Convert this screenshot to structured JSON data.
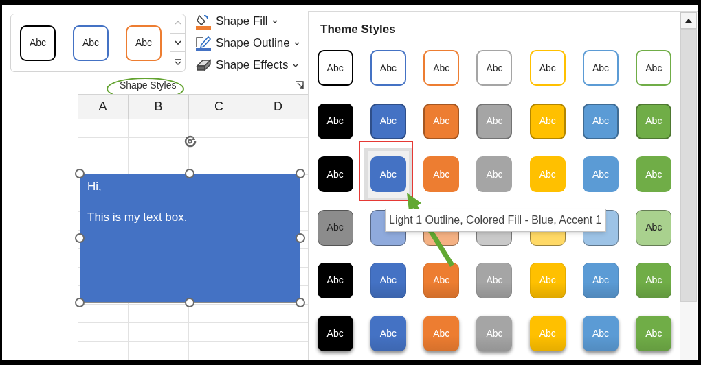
{
  "ribbon": {
    "gallery": {
      "styles": [
        {
          "label": "Abc",
          "color": "#000000"
        },
        {
          "label": "Abc",
          "color": "#4472c4"
        },
        {
          "label": "Abc",
          "color": "#ed7d31"
        }
      ],
      "scroll_buttons": [
        {
          "kind": "up",
          "disabled": true
        },
        {
          "kind": "down",
          "disabled": false
        },
        {
          "kind": "more",
          "disabled": false
        }
      ]
    },
    "commands": [
      {
        "kind": "fill",
        "label": "Shape Fill"
      },
      {
        "kind": "outline",
        "label": "Shape Outline"
      },
      {
        "kind": "effects",
        "label": "Shape Effects"
      }
    ],
    "group_label": "Shape Styles"
  },
  "sheet": {
    "columns": [
      "A",
      "B",
      "C",
      "D"
    ],
    "text_box": {
      "paragraphs": [
        "Hi,",
        "This is my text box."
      ]
    }
  },
  "panel": {
    "title": "Theme Styles",
    "rows": [
      {
        "kind": "outline",
        "tiles": [
          {
            "label": "Abc",
            "color": "#000000",
            "selected": false
          },
          {
            "label": "Abc",
            "color": "#4472c4",
            "selected": false
          },
          {
            "label": "Abc",
            "color": "#ed7d31",
            "selected": false
          },
          {
            "label": "Abc",
            "color": "#a5a5a5",
            "selected": false
          },
          {
            "label": "Abc",
            "color": "#ffc000",
            "selected": false
          },
          {
            "label": "Abc",
            "color": "#5b9bd5",
            "selected": false
          },
          {
            "label": "Abc",
            "color": "#70ad47",
            "selected": false
          }
        ]
      },
      {
        "kind": "solid",
        "tiles": [
          {
            "label": "Abc",
            "color": "#000000",
            "selected": false
          },
          {
            "label": "Abc",
            "color": "#4472c4",
            "selected": false
          },
          {
            "label": "Abc",
            "color": "#ed7d31",
            "selected": false
          },
          {
            "label": "Abc",
            "color": "#a5a5a5",
            "selected": false
          },
          {
            "label": "Abc",
            "color": "#ffc000",
            "selected": false
          },
          {
            "label": "Abc",
            "color": "#5b9bd5",
            "selected": false
          },
          {
            "label": "Abc",
            "color": "#70ad47",
            "selected": false
          }
        ]
      },
      {
        "kind": "flat",
        "tiles": [
          {
            "label": "Abc",
            "color": "#000000",
            "selected": false
          },
          {
            "label": "Abc",
            "color": "#4472c4",
            "selected": true
          },
          {
            "label": "Abc",
            "color": "#ed7d31",
            "selected": false
          },
          {
            "label": "Abc",
            "color": "#a5a5a5",
            "selected": false
          },
          {
            "label": "Abc",
            "color": "#ffc000",
            "selected": false
          },
          {
            "label": "Abc",
            "color": "#5b9bd5",
            "selected": false
          },
          {
            "label": "Abc",
            "color": "#70ad47",
            "selected": false
          }
        ]
      },
      {
        "kind": "light",
        "tiles": [
          {
            "label": "Abc",
            "color": "#8c8c8c",
            "selected": false
          },
          {
            "color": "#8faadc",
            "selected": false
          },
          {
            "color": "#f4b183",
            "selected": false
          },
          {
            "color": "#c9c9c9",
            "selected": false
          },
          {
            "color": "#ffd966",
            "selected": false
          },
          {
            "color": "#9dc3e6",
            "selected": false
          },
          {
            "label": "Abc",
            "color": "#a9d18e",
            "selected": false
          }
        ]
      },
      {
        "kind": "gradient",
        "tiles": [
          {
            "label": "Abc",
            "color": "#000000",
            "selected": false
          },
          {
            "label": "Abc",
            "color": "#4472c4",
            "selected": false
          },
          {
            "label": "Abc",
            "color": "#ed7d31",
            "selected": false
          },
          {
            "label": "Abc",
            "color": "#a5a5a5",
            "selected": false
          },
          {
            "label": "Abc",
            "color": "#ffc000",
            "selected": false
          },
          {
            "label": "Abc",
            "color": "#5b9bd5",
            "selected": false
          },
          {
            "label": "Abc",
            "color": "#70ad47",
            "selected": false
          }
        ]
      },
      {
        "kind": "shadow",
        "tiles": [
          {
            "label": "Abc",
            "color": "#000000",
            "selected": false
          },
          {
            "label": "Abc",
            "color": "#4472c4",
            "selected": false
          },
          {
            "label": "Abc",
            "color": "#ed7d31",
            "selected": false
          },
          {
            "label": "Abc",
            "color": "#a5a5a5",
            "selected": false
          },
          {
            "label": "Abc",
            "color": "#ffc000",
            "selected": false
          },
          {
            "label": "Abc",
            "color": "#5b9bd5",
            "selected": false
          },
          {
            "label": "Abc",
            "color": "#70ad47",
            "selected": false
          }
        ]
      }
    ],
    "tooltip": "Light 1 Outline, Colored Fill - Blue, Accent 1"
  }
}
